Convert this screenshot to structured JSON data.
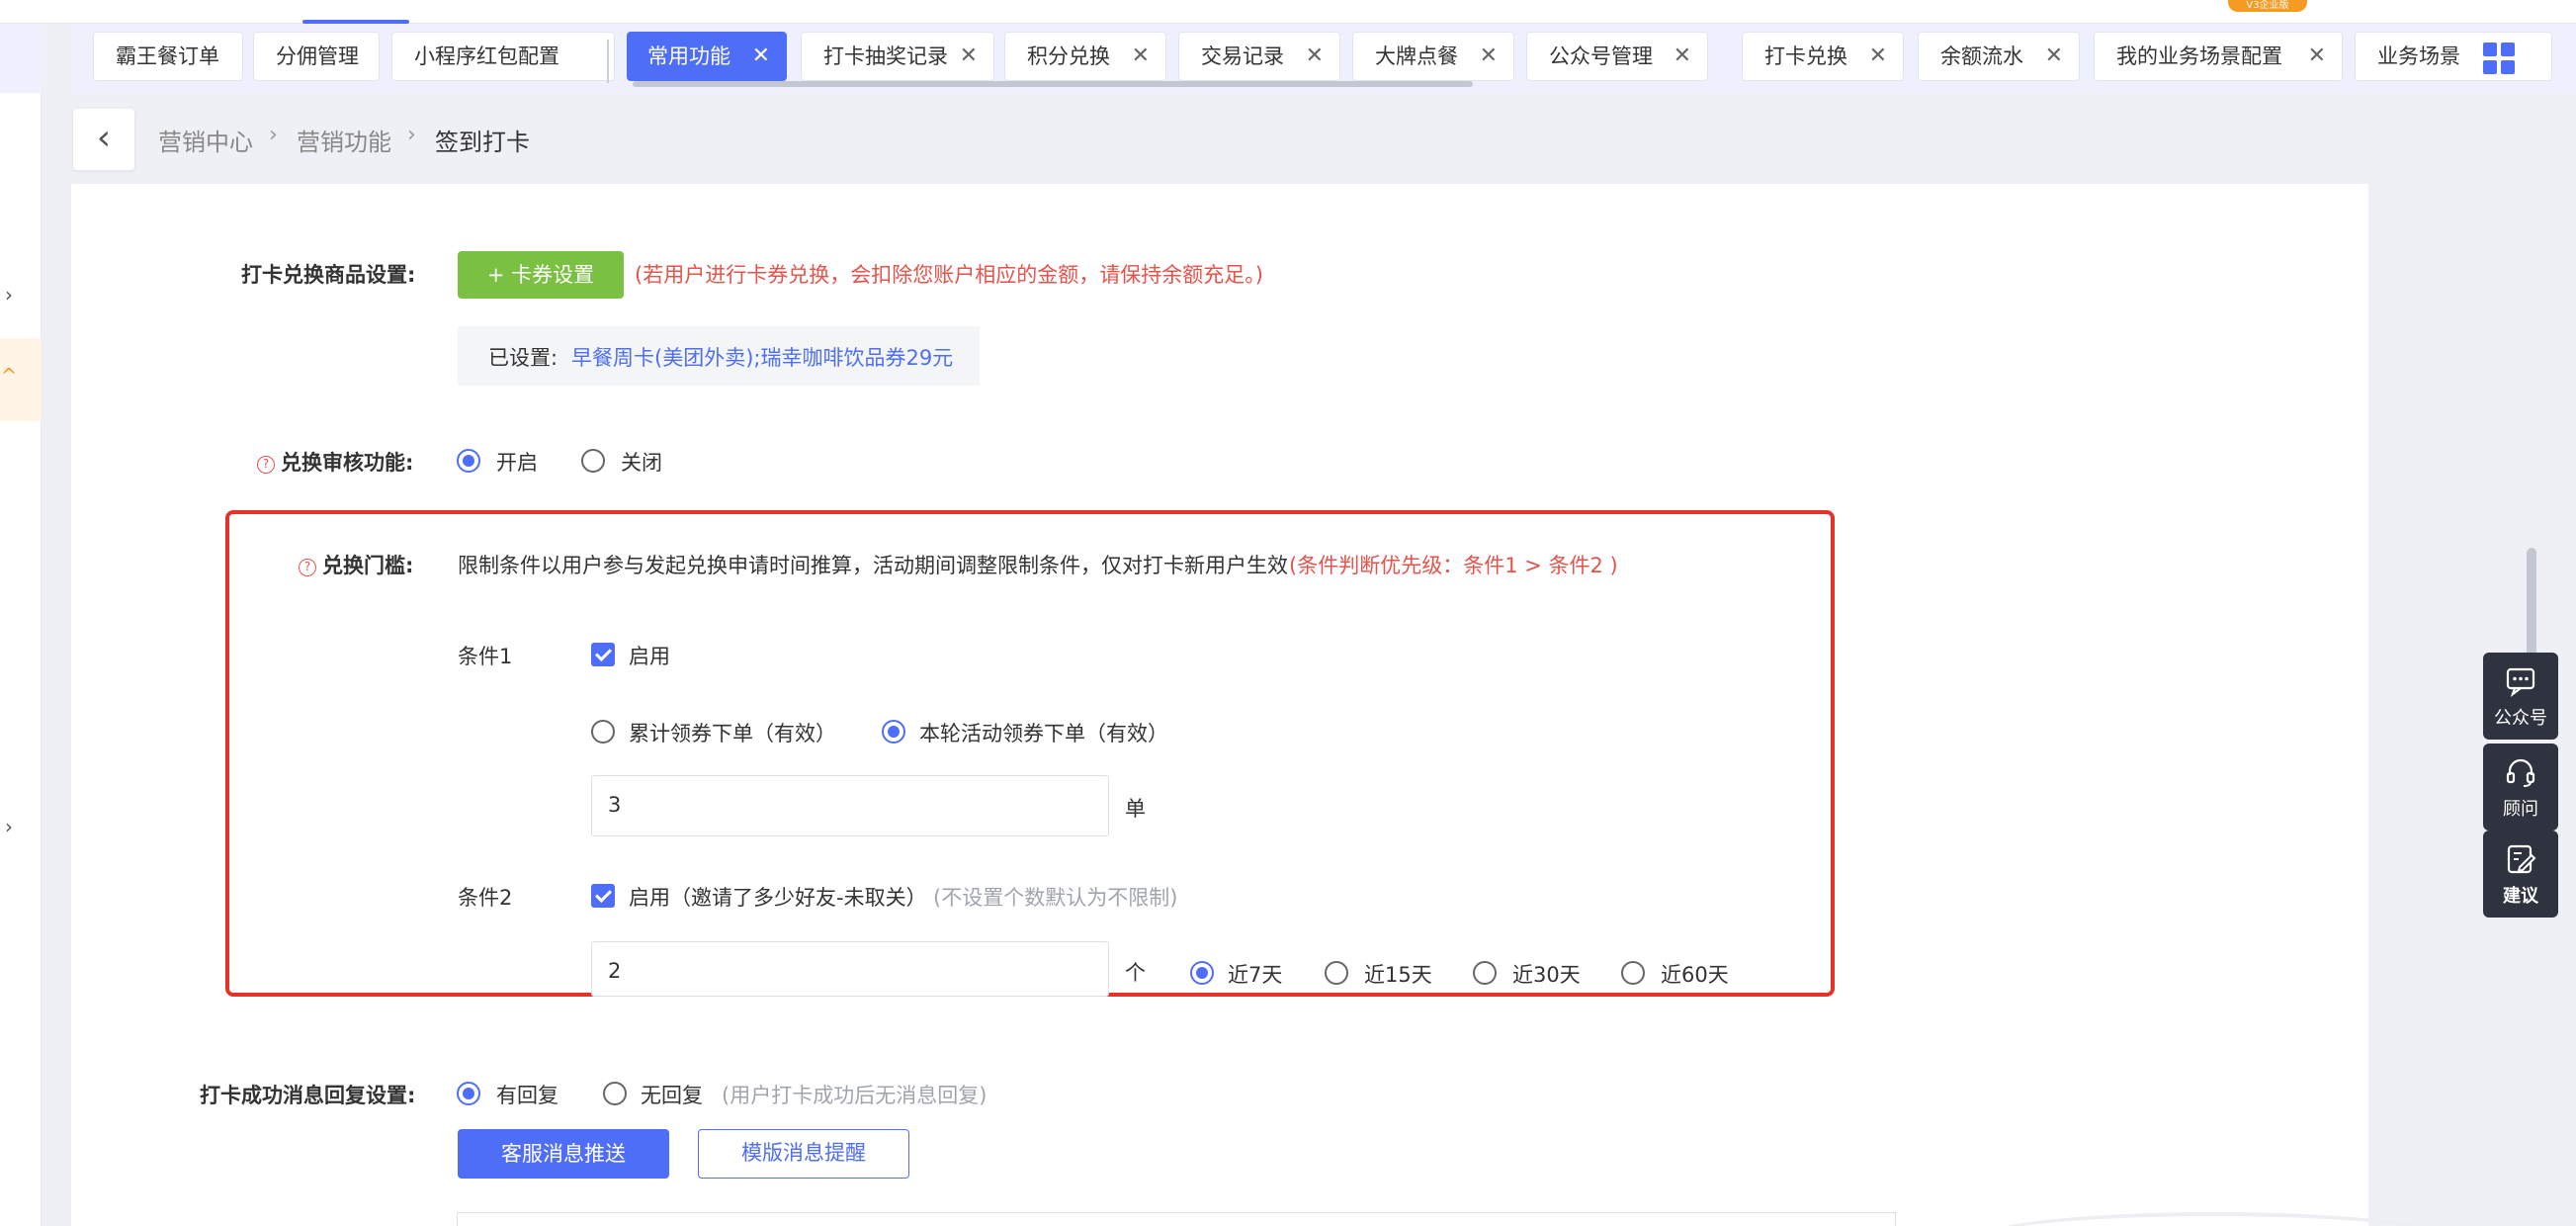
{
  "top_badge": "V3企业版",
  "tabs": [
    {
      "label": "霸王餐订单",
      "active": false,
      "closable": false
    },
    {
      "label": "分佣管理",
      "active": false,
      "closable": false
    },
    {
      "label": "小程序红包配置",
      "active": false,
      "closable": false
    },
    {
      "label": "常用功能",
      "active": true,
      "closable": true
    },
    {
      "label": "打卡抽奖记录",
      "active": false,
      "closable": true
    },
    {
      "label": "积分兑换",
      "active": false,
      "closable": true
    },
    {
      "label": "交易记录",
      "active": false,
      "closable": true
    },
    {
      "label": "大牌点餐",
      "active": false,
      "closable": true
    },
    {
      "label": "公众号管理",
      "active": false,
      "closable": true
    },
    {
      "label": "打卡兑换",
      "active": false,
      "closable": true
    },
    {
      "label": "余额流水",
      "active": false,
      "closable": true
    },
    {
      "label": "我的业务场景配置",
      "active": false,
      "closable": true
    },
    {
      "label": "业务场景",
      "active": false,
      "closable": false
    }
  ],
  "breadcrumb": [
    "营销中心",
    "营销功能",
    "签到打卡"
  ],
  "breadcrumb_sep": "›",
  "form": {
    "goods": {
      "label": "打卡兑换商品设置:",
      "button": "+ 卡券设置",
      "note": "(若用户进行卡券兑换，会扣除您账户相应的金额，请保持余额充足。)",
      "set_prefix": "已设置:",
      "set_value": "早餐周卡(美团外卖);瑞幸咖啡饮品券29元"
    },
    "audit": {
      "label": "兑换审核功能:",
      "options": [
        "开启",
        "关闭"
      ],
      "selected": "开启"
    },
    "threshold": {
      "label": "兑换门槛:",
      "desc": "限制条件以用户参与发起兑换申请时间推算，活动期间调整限制条件，仅对打卡新用户生效",
      "priority": "(条件判断优先级：条件1 > 条件2 )",
      "cond1": {
        "label": "条件1",
        "enable": "启用",
        "enabled": true,
        "options": [
          "累计领券下单（有效）",
          "本轮活动领券下单（有效）"
        ],
        "selected": "本轮活动领券下单（有效）",
        "value": "3",
        "unit": "单"
      },
      "cond2": {
        "label": "条件2",
        "enable": "启用（邀请了多少好友-未取关）",
        "enabled": true,
        "hint": "(不设置个数默认为不限制)",
        "value": "2",
        "unit": "个",
        "periods": [
          "近7天",
          "近15天",
          "近30天",
          "近60天"
        ],
        "selected": "近7天"
      }
    },
    "reply": {
      "label": "打卡成功消息回复设置:",
      "options": [
        "有回复",
        "无回复"
      ],
      "selected": "有回复",
      "hint": "(用户打卡成功后无消息回复)",
      "btn_primary": "客服消息推送",
      "btn_secondary": "模版消息提醒"
    }
  },
  "floating": [
    "公众号",
    "顾问",
    "建议"
  ],
  "colors": {
    "accent": "#4f6ef7",
    "green": "#7ac143",
    "red": "#e5534b",
    "highlight": "#e6332a"
  }
}
